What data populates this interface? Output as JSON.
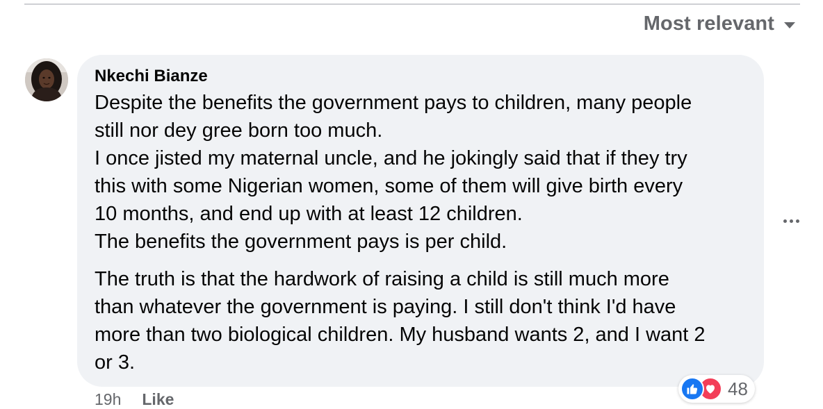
{
  "sort": {
    "label": "Most relevant",
    "icon": "caret-down-icon"
  },
  "comment": {
    "author": "Nkechi Bianze",
    "paragraphs": [
      [
        "Despite the benefits the government pays to children, many people",
        "still nor dey gree born too much.",
        "I once jisted my maternal uncle, and he jokingly said that if they try",
        "this with some Nigerian women, some of them will give birth every",
        "10 months, and end up with at least 12 children.",
        "The benefits the government pays is per child."
      ],
      [
        "The truth is that the hardwork of raising a child is still much more",
        "than whatever the government is paying. I still don't think I'd have",
        "more than two biological children. My husband wants 2, and I want 2",
        "or 3."
      ]
    ],
    "reactions": {
      "count": "48",
      "icons": [
        "like-icon",
        "love-icon"
      ]
    },
    "time": "19h",
    "like_label": "Like"
  },
  "colors": {
    "bubble": "#f0f2f5",
    "secondary_text": "#65676b",
    "like_blue": "#1877f2",
    "love_red": "#f33e58",
    "divider": "#ced0d4"
  }
}
